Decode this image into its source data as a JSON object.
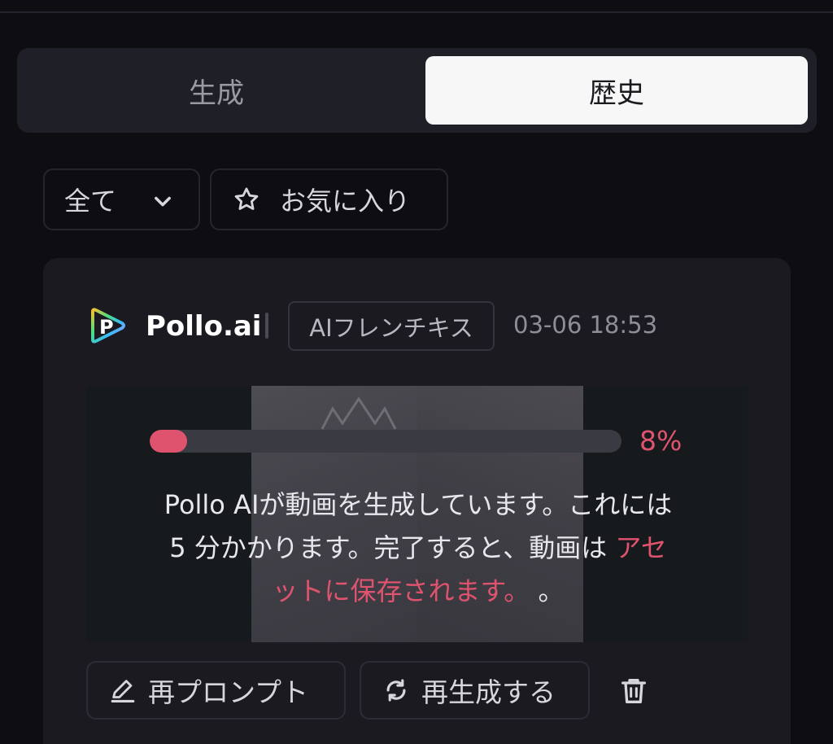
{
  "tabs": [
    {
      "label": "生成",
      "active": false
    },
    {
      "label": "歴史",
      "active": true
    }
  ],
  "filters": {
    "all_label": "全て",
    "favorites_label": "お気に入り"
  },
  "card": {
    "brand": "Pollo.ai",
    "model_tag": "AIフレンチキス",
    "timestamp": "03-06 18:53",
    "progress": {
      "percent": 8,
      "label": "8%"
    },
    "message": {
      "line1": "Pollo AIが動画を生成しています。これには",
      "line2_prefix": "5 分かかります。完了すると、動画は",
      "link_part1": "アセ",
      "link_part2": "ットに保存されます。",
      "suffix": "。"
    },
    "actions": {
      "reprompt_label": "再プロンプト",
      "regenerate_label": "再生成する"
    }
  },
  "colors": {
    "background": "#0d0d12",
    "card": "#1a1a20",
    "accent": "#e0536e",
    "active_tab": "#f7f7f8"
  },
  "icons": [
    "chevron-down-icon",
    "star-icon",
    "pollo-logo-icon",
    "pencil-icon",
    "refresh-icon",
    "trash-icon"
  ]
}
